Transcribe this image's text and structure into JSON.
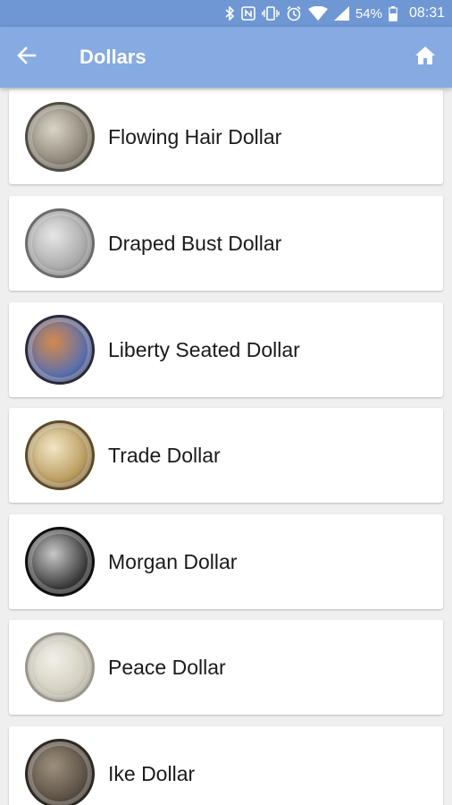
{
  "status_bar": {
    "battery": "54%",
    "time": "08:31"
  },
  "app_bar": {
    "title": "Dollars"
  },
  "items": [
    {
      "label": "Flowing Hair Dollar",
      "icon": "flowing-hair-dollar-coin",
      "colors": [
        "#d9d4c8",
        "#8c8576",
        "#524c40"
      ]
    },
    {
      "label": "Draped Bust Dollar",
      "icon": "draped-bust-dollar-coin",
      "colors": [
        "#e6e6e6",
        "#a9a9a9",
        "#6b6b6b"
      ]
    },
    {
      "label": "Liberty Seated Dollar",
      "icon": "liberty-seated-dollar-coin",
      "colors": [
        "#d48a4a",
        "#5a6fb0",
        "#2c2a3a"
      ]
    },
    {
      "label": "Trade Dollar",
      "icon": "trade-dollar-coin",
      "colors": [
        "#f3e6c4",
        "#b99a5e",
        "#5e4a26"
      ]
    },
    {
      "label": "Morgan Dollar",
      "icon": "morgan-dollar-coin",
      "colors": [
        "#c8c8c8",
        "#3a3a3a",
        "#0e0e0e"
      ]
    },
    {
      "label": "Peace Dollar",
      "icon": "peace-dollar-coin",
      "colors": [
        "#f1efe8",
        "#d2cebf",
        "#9a968a"
      ]
    },
    {
      "label": "Ike Dollar",
      "icon": "ike-dollar-coin",
      "colors": [
        "#9c8f7c",
        "#5a5044",
        "#2e2822"
      ]
    }
  ]
}
